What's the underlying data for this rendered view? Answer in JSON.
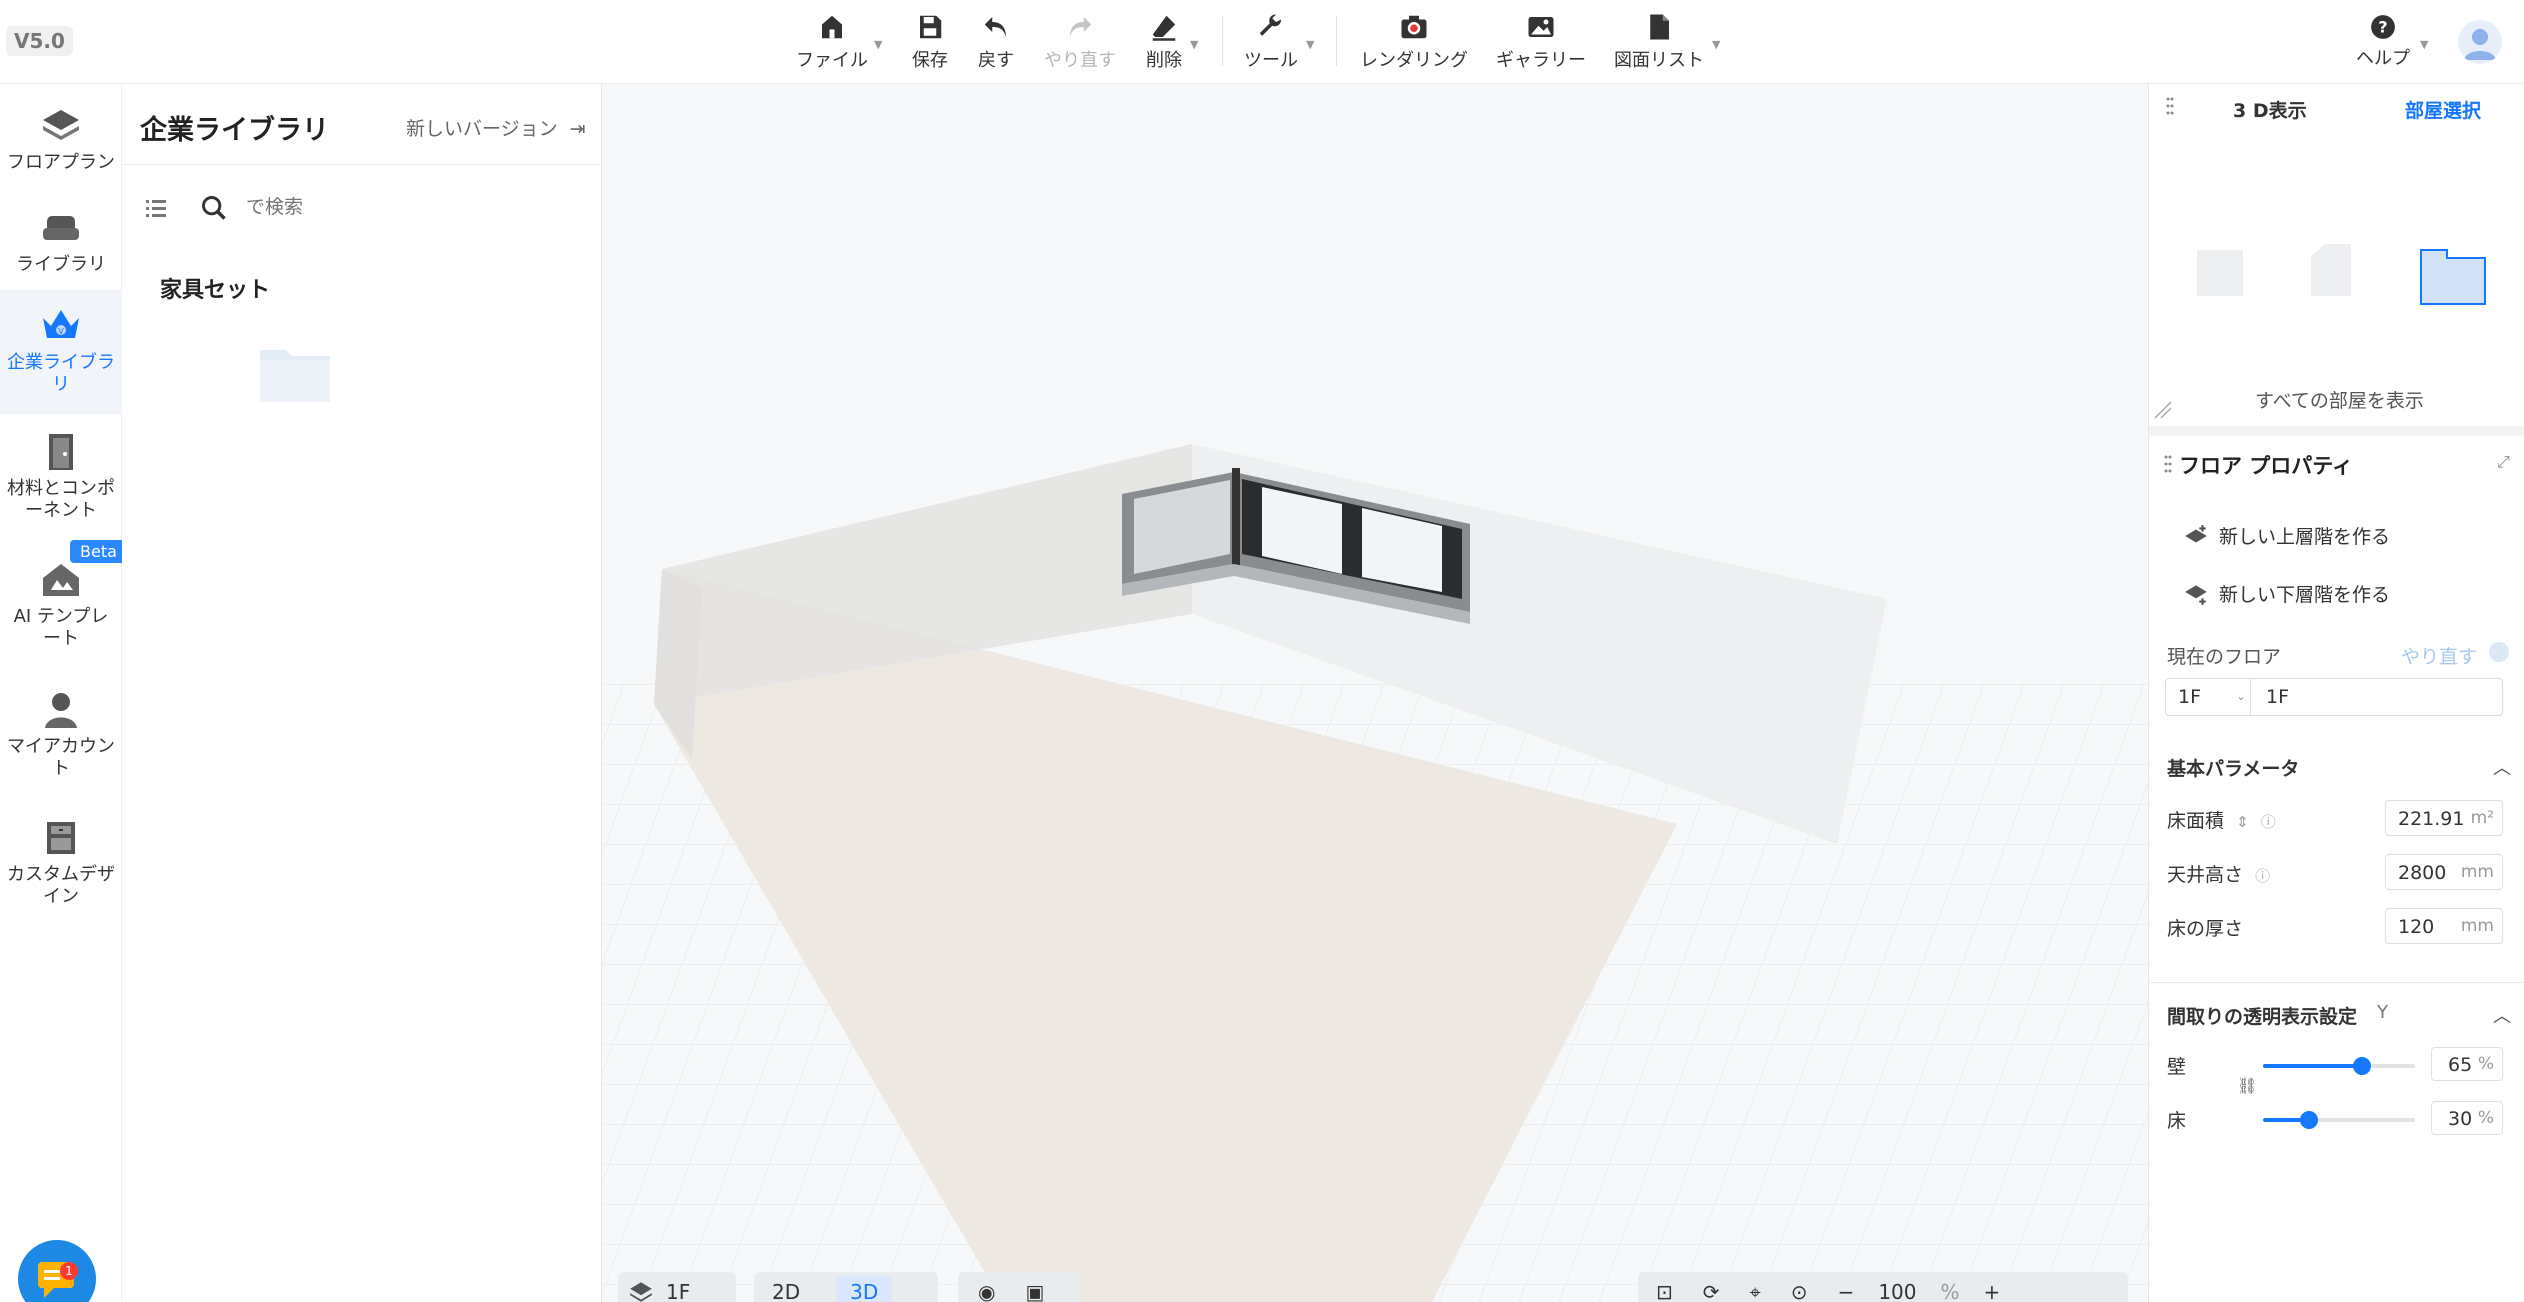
{
  "app": {
    "version": "V5.0"
  },
  "toolbar": {
    "file": "ファイル",
    "save": "保存",
    "undo": "戻す",
    "redo": "やり直す",
    "delete": "削除",
    "tools": "ツール",
    "rendering": "レンダリング",
    "gallery": "ギャラリー",
    "drawing_list": "図面リスト",
    "help": "ヘルプ"
  },
  "leftnav": {
    "floorplan": "フロアプラン",
    "library": "ライブラリ",
    "enterprise_library": "企業ライブラリ",
    "materials": "材料とコンポーネント",
    "ai_template": "AI テンプレート",
    "beta": "Beta",
    "my_account": "マイアカウント",
    "custom_design": "カスタムデザイン",
    "chat_badge": "1"
  },
  "library": {
    "title": "企業ライブラリ",
    "new_version": "新しいバージョン",
    "search_placeholder": "で検索",
    "furniture_set": "家具セット"
  },
  "viewport": {
    "floor_select": "1F",
    "view_2d": "2D",
    "view_3d": "3D",
    "zoom": "100",
    "zoom_unit": "%"
  },
  "rightpanel": {
    "view_3d": "3 D表示",
    "room_select": "部屋選択",
    "show_all_rooms": "すべての部屋を表示",
    "floor_properties": "フロア プロパティ",
    "new_upper_floor": "新しい上層階を作る",
    "new_lower_floor": "新しい下層階を作る",
    "current_floor": "現在のフロア",
    "redo": "やり直す",
    "floor_code": "1F",
    "floor_name": "1F",
    "basic_params": "基本パラメータ",
    "floor_area_label": "床面積",
    "floor_area_value": "221.91",
    "floor_area_unit": "m²",
    "ceiling_height_label": "天井高さ",
    "ceiling_height_value": "2800",
    "ceiling_height_unit": "mm",
    "floor_thickness_label": "床の厚さ",
    "floor_thickness_value": "120",
    "floor_thickness_unit": "mm",
    "transparency_title": "間取りの透明表示設定",
    "transparency_shortcut": "Y",
    "wall_label": "壁",
    "wall_value": "65",
    "floor_label": "床",
    "floor_value": "30",
    "percent_unit": "%"
  },
  "colors": {
    "accent": "#1677ff",
    "beta_badge": "#2b89ff"
  }
}
